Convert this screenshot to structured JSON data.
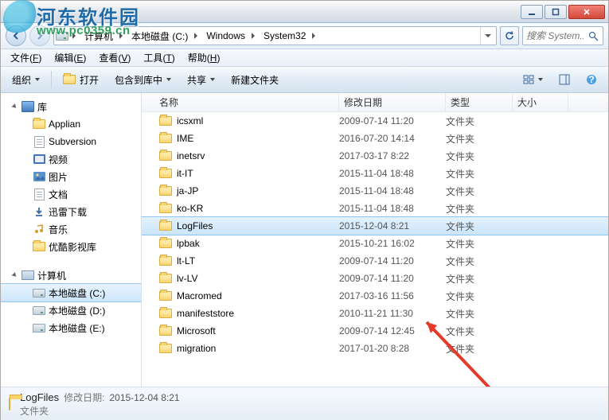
{
  "watermark": {
    "brand": "河东软件园",
    "url": "www.pc0359.cn"
  },
  "breadcrumbs": [
    {
      "label": "计算机"
    },
    {
      "label": "本地磁盘 (C:)"
    },
    {
      "label": "Windows"
    },
    {
      "label": "System32"
    }
  ],
  "search": {
    "placeholder": "搜索 System..."
  },
  "menubar": [
    {
      "label": "文件",
      "accel": "F"
    },
    {
      "label": "编辑",
      "accel": "E"
    },
    {
      "label": "查看",
      "accel": "V"
    },
    {
      "label": "工具",
      "accel": "T"
    },
    {
      "label": "帮助",
      "accel": "H"
    }
  ],
  "toolbar": {
    "organize": "组织",
    "open": "打开",
    "include": "包含到库中",
    "share": "共享",
    "newfolder": "新建文件夹"
  },
  "tree": {
    "libraries": {
      "label": "库",
      "items": [
        {
          "label": "Applian",
          "icon": "folder"
        },
        {
          "label": "Subversion",
          "icon": "doc"
        },
        {
          "label": "视频",
          "icon": "video"
        },
        {
          "label": "图片",
          "icon": "image"
        },
        {
          "label": "文档",
          "icon": "doc"
        },
        {
          "label": "迅雷下载",
          "icon": "download"
        },
        {
          "label": "音乐",
          "icon": "music"
        },
        {
          "label": "优酷影视库",
          "icon": "folder"
        }
      ]
    },
    "computer": {
      "label": "计算机",
      "items": [
        {
          "label": "本地磁盘 (C:)",
          "selected": true
        },
        {
          "label": "本地磁盘 (D:)"
        },
        {
          "label": "本地磁盘 (E:)"
        }
      ]
    }
  },
  "columns": {
    "name": "名称",
    "date": "修改日期",
    "type": "类型",
    "size": "大小"
  },
  "rows": [
    {
      "name": "icsxml",
      "date": "2009-07-14 11:20",
      "type": "文件夹"
    },
    {
      "name": "IME",
      "date": "2016-07-20 14:14",
      "type": "文件夹"
    },
    {
      "name": "inetsrv",
      "date": "2017-03-17 8:22",
      "type": "文件夹"
    },
    {
      "name": "it-IT",
      "date": "2015-11-04 18:48",
      "type": "文件夹"
    },
    {
      "name": "ja-JP",
      "date": "2015-11-04 18:48",
      "type": "文件夹"
    },
    {
      "name": "ko-KR",
      "date": "2015-11-04 18:48",
      "type": "文件夹"
    },
    {
      "name": "LogFiles",
      "date": "2015-12-04 8:21",
      "type": "文件夹",
      "selected": true
    },
    {
      "name": "lpbak",
      "date": "2015-10-21 16:02",
      "type": "文件夹"
    },
    {
      "name": "lt-LT",
      "date": "2009-07-14 11:20",
      "type": "文件夹"
    },
    {
      "name": "lv-LV",
      "date": "2009-07-14 11:20",
      "type": "文件夹"
    },
    {
      "name": "Macromed",
      "date": "2017-03-16 11:56",
      "type": "文件夹"
    },
    {
      "name": "manifeststore",
      "date": "2010-11-21 11:30",
      "type": "文件夹"
    },
    {
      "name": "Microsoft",
      "date": "2009-07-14 12:45",
      "type": "文件夹"
    },
    {
      "name": "migration",
      "date": "2017-01-20 8:28",
      "type": "文件夹"
    }
  ],
  "details": {
    "name": "LogFiles",
    "date_label": "修改日期:",
    "date_value": "2015-12-04 8:21",
    "type": "文件夹"
  }
}
